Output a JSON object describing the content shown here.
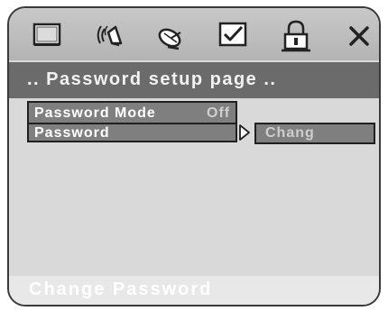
{
  "icon_bar": {
    "icons": [
      "monitor-icon",
      "speaker-icon",
      "satellite-dish-icon",
      "checkbox-icon",
      "lock-icon",
      "close-icon"
    ],
    "active_icon": "lock-icon"
  },
  "header": {
    "title": ".. Password setup page .."
  },
  "menu": {
    "items": [
      {
        "label": "Password Mode",
        "value": "Off"
      },
      {
        "label": "Password"
      }
    ],
    "submenu": {
      "value": "Chang"
    }
  },
  "status": {
    "text": "Change Password"
  },
  "colors": {
    "panel_bg": "#d9d9d9",
    "title_bg": "#6b6b6b",
    "menu_bg": "#7f7f7f",
    "status_bg": "#e8e8e8",
    "border": "#202020"
  }
}
